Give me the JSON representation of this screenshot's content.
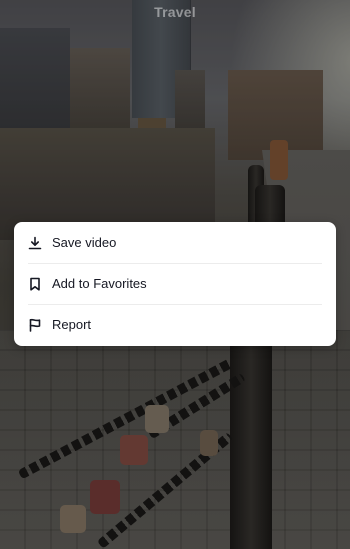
{
  "header": {
    "title": "Travel"
  },
  "menu": {
    "items": [
      {
        "label": "Save video",
        "icon": "download-icon"
      },
      {
        "label": "Add to Favorites",
        "icon": "bookmark-icon"
      },
      {
        "label": "Report",
        "icon": "flag-icon"
      }
    ]
  },
  "colors": {
    "menu_background": "#ffffff",
    "menu_text": "#161823",
    "divider": "#ececec"
  }
}
